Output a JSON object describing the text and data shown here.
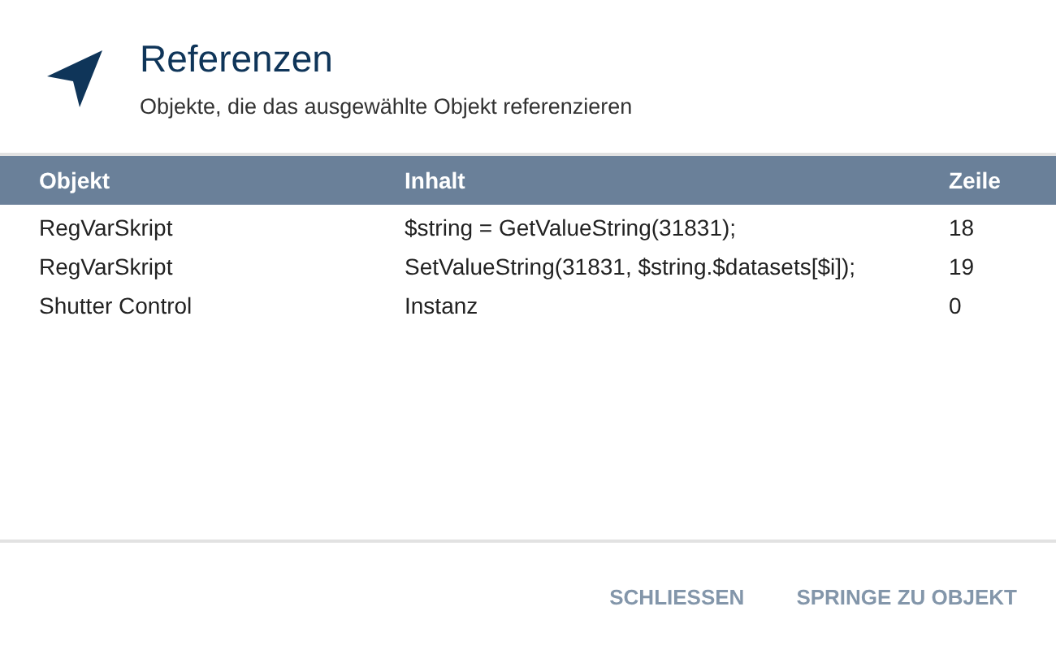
{
  "dialog": {
    "title": "Referenzen",
    "subtitle": "Objekte, die das ausgewählte Objekt referenzieren"
  },
  "table": {
    "columns": [
      "Objekt",
      "Inhalt",
      "Zeile"
    ],
    "rows": [
      [
        "RegVarSkript",
        "$string = GetValueString(31831);",
        "18"
      ],
      [
        "RegVarSkript",
        "SetValueString(31831, $string.$datasets[$i]);",
        "19"
      ],
      [
        "Shutter Control",
        "Instanz",
        "0"
      ]
    ]
  },
  "buttons": [
    "SCHLIESSEN",
    "SPRINGE ZU OBJEKT"
  ]
}
